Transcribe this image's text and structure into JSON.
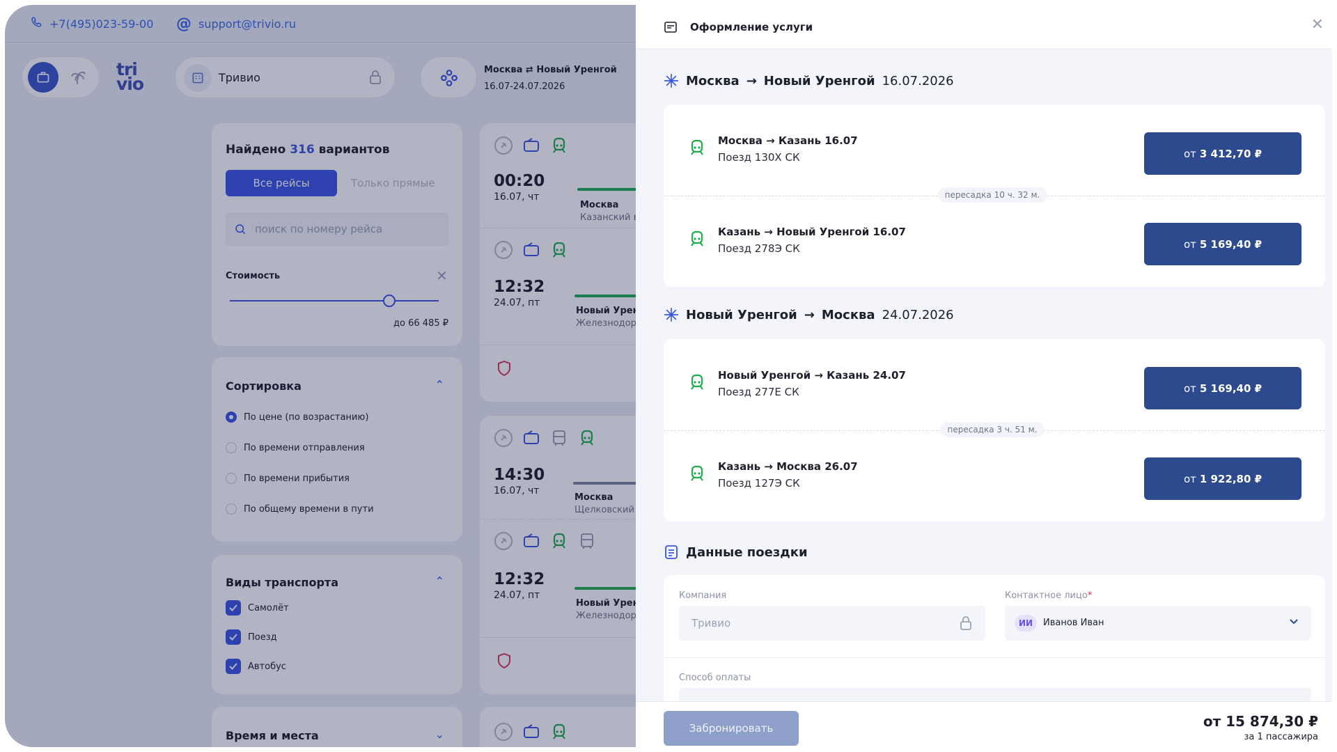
{
  "topbar": {
    "phone": "+7(495)023-59-00",
    "email": "support@trivio.ru"
  },
  "header": {
    "logo_line1": "tri",
    "logo_line2": "vio",
    "company": "Тривио",
    "route_title": "Москва ⇄ Новый Уренгой",
    "route_dates": "16.07-24.07.2026"
  },
  "filters": {
    "found_prefix": "Найдено",
    "found_count": "316",
    "found_suffix": "вариантов",
    "tab_all": "Все рейсы",
    "tab_direct": "Только прямые",
    "search_placeholder": "поиск по номеру рейса",
    "price_label": "Стоимость",
    "price_max": "до 66 485 ₽",
    "sort_title": "Сортировка",
    "sort_options": [
      "По цене (по возрастанию)",
      "По времени отправления",
      "По времени прибытия",
      "По общему времени в пути"
    ],
    "transport_title": "Виды транспорта",
    "transport_options": [
      "Самолёт",
      "Поезд",
      "Автобус"
    ],
    "time_title": "Время и места"
  },
  "results": [
    {
      "time": "00:20",
      "date": "16.07, чт",
      "city": "Москва",
      "station": "Казанский вок"
    },
    {
      "time": "12:32",
      "date": "24.07, пт",
      "city": "Новый Уренго",
      "station": "Железнодорож"
    },
    {
      "time": "14:30",
      "date": "16.07, чт",
      "city": "Москва",
      "station": "Щелковский (Ц"
    },
    {
      "time": "12:32",
      "date": "24.07, пт",
      "city": "Новый Уренго",
      "station": "Железнодорож"
    }
  ],
  "modal": {
    "title": "Оформление услуги",
    "outbound": {
      "from": "Москва",
      "arrow": "→",
      "to": "Новый Уренгой",
      "date": "16.07.2026",
      "legs": [
        {
          "title": "Москва → Казань 16.07",
          "train": "Поезд 130Х СК",
          "price_prefix": "от",
          "price": "3 412,70 ₽"
        },
        {
          "title": "Казань → Новый Уренгой 16.07",
          "train": "Поезд 278Э СК",
          "price_prefix": "от",
          "price": "5 169,40 ₽"
        }
      ],
      "transfer": "пересадка 10 ч. 32 м."
    },
    "inbound": {
      "from": "Новый Уренгой",
      "arrow": "→",
      "to": "Москва",
      "date": "24.07.2026",
      "legs": [
        {
          "title": "Новый Уренгой → Казань 24.07",
          "train": "Поезд 277Е СК",
          "price_prefix": "от",
          "price": "5 169,40 ₽"
        },
        {
          "title": "Казань → Москва 26.07",
          "train": "Поезд 127Э СК",
          "price_prefix": "от",
          "price": "1 922,80 ₽"
        }
      ],
      "transfer": "пересадка 3 ч. 51 м."
    },
    "trip_data_title": "Данные поездки",
    "company_label": "Компания",
    "company_value": "Тривио",
    "contact_label": "Контактное лицо",
    "contact_required": "*",
    "contact_initials": "ИИ",
    "contact_value": "Иванов Иван",
    "payment_label": "Способ оплаты",
    "book_button": "Забронировать",
    "total": "от 15 874,30 ₽",
    "total_note": "за 1 пассажира"
  },
  "colors": {
    "accent": "#3a56e0",
    "price_button": "#2e4a8e",
    "train_icon": "#1fae4b",
    "book_disabled": "#8ea0c9"
  }
}
